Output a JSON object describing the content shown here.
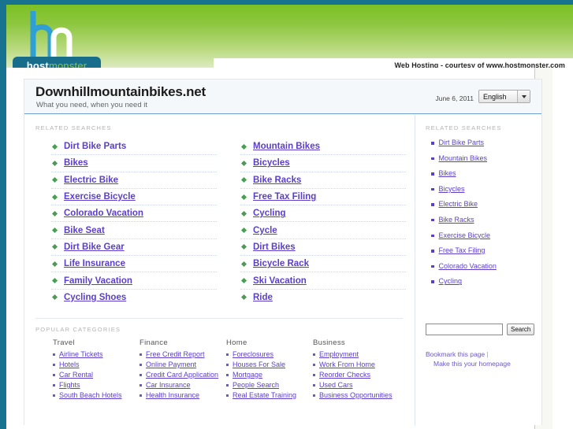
{
  "banner": {
    "logo_icon": "hostmonster-hm-monogram",
    "brand_part1": "host",
    "brand_part2": "monster",
    "hosting_note": "Web Hosting - courtesy of www.hostmonster.com"
  },
  "header": {
    "site_title": "Downhillmountainbikes.net",
    "tagline": "What you need, when you need it",
    "date": "June 6, 2011",
    "language": "English",
    "language_options": [
      "English"
    ]
  },
  "related_searches": {
    "label": "RELATED SEARCHES",
    "col1": [
      {
        "label": "Dirt Bike Parts",
        "underlined": false
      },
      {
        "label": "Bikes",
        "underlined": true
      },
      {
        "label": "Electric Bike",
        "underlined": true
      },
      {
        "label": "Exercise Bicycle",
        "underlined": true
      },
      {
        "label": "Colorado Vacation",
        "underlined": true
      },
      {
        "label": "Bike Seat",
        "underlined": true
      },
      {
        "label": "Dirt Bike Gear",
        "underlined": true
      },
      {
        "label": "Life Insurance",
        "underlined": true
      },
      {
        "label": "Family Vacation",
        "underlined": true
      },
      {
        "label": "Cycling Shoes",
        "underlined": true
      }
    ],
    "col2": [
      {
        "label": "Mountain Bikes",
        "underlined": true
      },
      {
        "label": "Bicycles",
        "underlined": true
      },
      {
        "label": "Bike Racks",
        "underlined": true
      },
      {
        "label": "Free Tax Filing",
        "underlined": true
      },
      {
        "label": "Cycling",
        "underlined": true
      },
      {
        "label": "Cycle",
        "underlined": true
      },
      {
        "label": "Dirt Bikes",
        "underlined": true
      },
      {
        "label": "Bicycle Rack",
        "underlined": true
      },
      {
        "label": "Ski Vacation",
        "underlined": true
      },
      {
        "label": "Ride",
        "underlined": true
      }
    ]
  },
  "popular_categories": {
    "label": "POPULAR CATEGORIES",
    "columns": [
      {
        "heading": "Travel",
        "links": [
          "Airline Tickets",
          "Hotels",
          "Car Rental",
          "Flights",
          "South Beach Hotels"
        ]
      },
      {
        "heading": "Finance",
        "links": [
          "Free Credit Report",
          "Online Payment",
          "Credit Card Application",
          "Car Insurance",
          "Health Insurance"
        ]
      },
      {
        "heading": "Home",
        "links": [
          "Foreclosures",
          "Houses For Sale",
          "Mortgage",
          "People Search",
          "Real Estate Training"
        ]
      },
      {
        "heading": "Business",
        "links": [
          "Employment",
          "Work From Home",
          "Reorder Checks",
          "Used Cars",
          "Business Opportunities"
        ]
      }
    ]
  },
  "sidebar": {
    "label": "RELATED SEARCHES",
    "links": [
      "Dirt Bike Parts",
      "Mountain Bikes",
      "Bikes",
      "Bicycles",
      "Electric Bike",
      "Bike Racks",
      "Exercise Bicycle",
      "Free Tax Filing",
      "Colorado Vacation",
      "Cycling"
    ],
    "search": {
      "value": "",
      "placeholder": "",
      "button_label": "Search"
    },
    "bookmark_label": "Bookmark this page",
    "separator": "|",
    "homepage_label": "Make this your homepage"
  },
  "colors": {
    "frame": "#17738f",
    "banner_green": "#8cc63f",
    "link_purple": "#5b3ecc",
    "bullet_green": "#4a9c52",
    "title_border": "#6f9fd1"
  }
}
